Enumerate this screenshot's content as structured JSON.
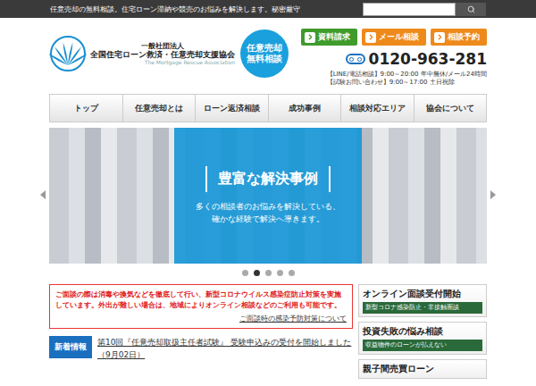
{
  "topbar": {
    "tagline": "任意売却の無料相談。住宅ローン滞納や競売のお悩みを解決します。秘密厳守"
  },
  "logo": {
    "org_type": "一般社団法人",
    "name": "全国住宅ローン救済・任意売却支援協会",
    "english": "The Mortgage Rescue Association"
  },
  "badge": {
    "line1": "任意売却",
    "line2": "無料相談"
  },
  "actions": [
    {
      "label": "資料請求",
      "color": "#3f9b2c"
    },
    {
      "label": "メール相談",
      "color": "#ee8a1c"
    },
    {
      "label": "相談予約",
      "color": "#ee8a1c"
    }
  ],
  "contact": {
    "phone": "0120-963-281",
    "hours": [
      "【LINE/電話相談】9:00～20:00 年中無休/メール24時間",
      "【試験お問い合わせ】9:00～17:00 土日祝除"
    ]
  },
  "nav": [
    {
      "label": "トップ",
      "selected": false
    },
    {
      "label": "任意売却とは",
      "selected": false
    },
    {
      "label": "ローン返済相談",
      "selected": false
    },
    {
      "label": "成功事例",
      "selected": false
    },
    {
      "label": "相談対応エリア",
      "selected": false
    },
    {
      "label": "協会について",
      "selected": false
    }
  ],
  "hero": {
    "title": "豊富な解決事例",
    "lines": [
      "多くの相談者のお悩みを解決している、",
      "確かな経験で解決へ導きます。"
    ]
  },
  "slides": [
    {
      "selected": false
    },
    {
      "selected": true
    },
    {
      "selected": false
    },
    {
      "selected": false
    },
    {
      "selected": false
    }
  ],
  "notice": {
    "text": "ご面談の際は消毒や換気などを徹底して行い、新型コロナウイルス感染症防止対策を実施しています。外出が難しい場合は、地域によりオンライン相談などのご利用も可能です。",
    "link": "ご面談時の感染予防対策について"
  },
  "news": {
    "label": "新着情報",
    "items": [
      {
        "text": "第10回『任意売却取扱主任者試験』 受験申込みの受付を開始しました（9月02日）"
      }
    ]
  },
  "side_banners": [
    {
      "title": "オンライン面談受付開始",
      "subtitle": "新型コロナ感染防止・非接触面談"
    },
    {
      "title": "投資失敗の悩み相談",
      "subtitle": "収益物件のローンが払えない"
    },
    {
      "title": "親子間売買ローン"
    }
  ]
}
